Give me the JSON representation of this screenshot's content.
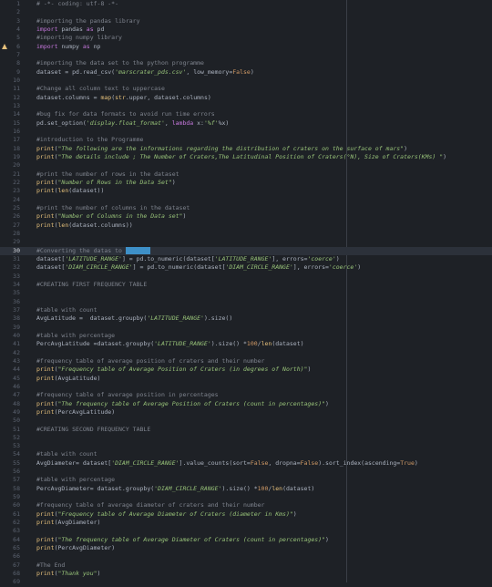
{
  "editor": {
    "active_line": 30,
    "warning_line": 6,
    "lines": [
      [
        [
          "c",
          "# -*- coding: utf-8 -*-"
        ]
      ],
      [],
      [
        [
          "c",
          "#importing the pandas library"
        ]
      ],
      [
        [
          "k",
          "import"
        ],
        [
          "p",
          " pandas "
        ],
        [
          "k",
          "as"
        ],
        [
          "p",
          " pd"
        ]
      ],
      [
        [
          "c",
          "#importing numpy library"
        ]
      ],
      [
        [
          "k",
          "import"
        ],
        [
          "p",
          " numpy "
        ],
        [
          "k",
          "as"
        ],
        [
          "p",
          " np"
        ]
      ],
      [],
      [
        [
          "c",
          "#importing the data set to the python programme"
        ]
      ],
      [
        [
          "p",
          "dataset = pd.read_csv("
        ],
        [
          "s",
          "'marscrater_pds.csv'"
        ],
        [
          "p",
          ", low_memory="
        ],
        [
          "n",
          "False"
        ],
        [
          "p",
          ")"
        ]
      ],
      [],
      [
        [
          "c",
          "#Change all column text to uppercase"
        ]
      ],
      [
        [
          "p",
          "dataset.columns = "
        ],
        [
          "f",
          "map"
        ],
        [
          "p",
          "("
        ],
        [
          "f",
          "str"
        ],
        [
          "p",
          ".upper, dataset.columns)"
        ]
      ],
      [],
      [
        [
          "c",
          "#bug fix for data formats to avoid run time errors"
        ]
      ],
      [
        [
          "p",
          "pd.set_option("
        ],
        [
          "s",
          "'display.float_format'"
        ],
        [
          "p",
          ", "
        ],
        [
          "k",
          "lambda"
        ],
        [
          "p",
          " x:"
        ],
        [
          "s",
          "'%f'"
        ],
        [
          "p",
          "%x)"
        ]
      ],
      [],
      [
        [
          "c",
          "#introduction to the Programme"
        ]
      ],
      [
        [
          "f",
          "print"
        ],
        [
          "p",
          "("
        ],
        [
          "s",
          "\"The following are the informations regarding the distribution of craters on the surface of mars\""
        ],
        [
          "p",
          ")"
        ]
      ],
      [
        [
          "f",
          "print"
        ],
        [
          "p",
          "("
        ],
        [
          "s",
          "\"The details include ; The Number of Craters,The Latitudinal Position of Craters(°N), Size of Craters(KMs) \""
        ],
        [
          "p",
          ")"
        ]
      ],
      [],
      [
        [
          "c",
          "#print the number of rows in the dataset"
        ]
      ],
      [
        [
          "f",
          "print"
        ],
        [
          "p",
          "("
        ],
        [
          "s",
          "\"Number of Rows in the Data Set\""
        ],
        [
          "p",
          ")"
        ]
      ],
      [
        [
          "f",
          "print"
        ],
        [
          "p",
          "("
        ],
        [
          "f",
          "len"
        ],
        [
          "p",
          "(dataset))"
        ]
      ],
      [],
      [
        [
          "c",
          "#print the number of columns in the dataset"
        ]
      ],
      [
        [
          "f",
          "print"
        ],
        [
          "p",
          "("
        ],
        [
          "s",
          "\"Number of Columns in the Data set\""
        ],
        [
          "p",
          ")"
        ]
      ],
      [
        [
          "f",
          "print"
        ],
        [
          "p",
          "("
        ],
        [
          "f",
          "len"
        ],
        [
          "p",
          "(dataset.columns))"
        ]
      ],
      [],
      [],
      [
        [
          "c",
          "#Converting the datas to "
        ],
        [
          "h",
          "numeric"
        ]
      ],
      [
        [
          "p",
          "dataset["
        ],
        [
          "s",
          "'LATITUDE_RANGE'"
        ],
        [
          "p",
          "] = pd.to_numeric(dataset["
        ],
        [
          "s",
          "'LATITUDE_RANGE'"
        ],
        [
          "p",
          "], errors="
        ],
        [
          "s",
          "'coerce'"
        ],
        [
          "p",
          ")"
        ]
      ],
      [
        [
          "p",
          "dataset["
        ],
        [
          "s",
          "'DIAM_CIRCLE_RANGE'"
        ],
        [
          "p",
          "] = pd.to_numeric(dataset["
        ],
        [
          "s",
          "'DIAM_CIRCLE_RANGE'"
        ],
        [
          "p",
          "], errors="
        ],
        [
          "s",
          "'coerce'"
        ],
        [
          "p",
          ")"
        ]
      ],
      [],
      [
        [
          "c",
          "#CREATING FIRST FREQUENCY TABLE"
        ]
      ],
      [],
      [],
      [
        [
          "c",
          "#table with count"
        ]
      ],
      [
        [
          "p",
          "AvgLatitude =  dataset.groupby("
        ],
        [
          "s",
          "'LATITUDE_RANGE'"
        ],
        [
          "p",
          ").size()"
        ]
      ],
      [],
      [
        [
          "c",
          "#table with percentage"
        ]
      ],
      [
        [
          "p",
          "PercAvgLatitude =dataset.groupby("
        ],
        [
          "s",
          "'LATITUDE_RANGE'"
        ],
        [
          "p",
          ").size() *"
        ],
        [
          "n",
          "100"
        ],
        [
          "p",
          "/"
        ],
        [
          "f",
          "len"
        ],
        [
          "p",
          "(dataset)"
        ]
      ],
      [],
      [
        [
          "c",
          "#frequency table of average position of craters and their number"
        ]
      ],
      [
        [
          "f",
          "print"
        ],
        [
          "p",
          "("
        ],
        [
          "s",
          "\"Frequency table of Average Position of Craters (in degrees of North)\""
        ],
        [
          "p",
          ")"
        ]
      ],
      [
        [
          "f",
          "print"
        ],
        [
          "p",
          "(AvgLatitude)"
        ]
      ],
      [],
      [
        [
          "c",
          "#frequency table of average position in percentages"
        ]
      ],
      [
        [
          "f",
          "print"
        ],
        [
          "p",
          "("
        ],
        [
          "s",
          "\"The frequency table of Average Position of Craters (count in percentages)\""
        ],
        [
          "p",
          ")"
        ]
      ],
      [
        [
          "f",
          "print"
        ],
        [
          "p",
          "(PercAvgLatitude)"
        ]
      ],
      [],
      [
        [
          "c",
          "#CREATING SECOND FREQUENCY TABLE"
        ]
      ],
      [],
      [],
      [
        [
          "c",
          "#table with count"
        ]
      ],
      [
        [
          "p",
          "AvgDiameter= dataset["
        ],
        [
          "s",
          "'DIAM_CIRCLE_RANGE'"
        ],
        [
          "p",
          "].value_counts(sort="
        ],
        [
          "n",
          "False"
        ],
        [
          "p",
          ", dropna="
        ],
        [
          "n",
          "False"
        ],
        [
          "p",
          ").sort_index(ascending="
        ],
        [
          "n",
          "True"
        ],
        [
          "p",
          ")"
        ]
      ],
      [],
      [
        [
          "c",
          "#table with percentage"
        ]
      ],
      [
        [
          "p",
          "PercAvgDiameter= dataset.groupby("
        ],
        [
          "s",
          "'DIAM_CIRCLE_RANGE'"
        ],
        [
          "p",
          ").size() *"
        ],
        [
          "n",
          "100"
        ],
        [
          "p",
          "/"
        ],
        [
          "f",
          "len"
        ],
        [
          "p",
          "(dataset)"
        ]
      ],
      [],
      [
        [
          "c",
          "#frequency table of average diameter of craters and their number"
        ]
      ],
      [
        [
          "f",
          "print"
        ],
        [
          "p",
          "("
        ],
        [
          "s",
          "\"Frequency table of Average Diameter of Craters (diameter in Kms)\""
        ],
        [
          "p",
          ")"
        ]
      ],
      [
        [
          "f",
          "print"
        ],
        [
          "p",
          "(AvgDiameter)"
        ]
      ],
      [],
      [
        [
          "f",
          "print"
        ],
        [
          "p",
          "("
        ],
        [
          "s",
          "\"The frequency table of Average Diameter of Craters (count in percentages)\""
        ],
        [
          "p",
          ")"
        ]
      ],
      [
        [
          "f",
          "print"
        ],
        [
          "p",
          "(PercAvgDiameter)"
        ]
      ],
      [],
      [
        [
          "c",
          "#The End"
        ]
      ],
      [
        [
          "f",
          "print"
        ],
        [
          "p",
          "("
        ],
        [
          "s",
          "\"Thank you\""
        ],
        [
          "p",
          ")"
        ]
      ],
      []
    ]
  }
}
